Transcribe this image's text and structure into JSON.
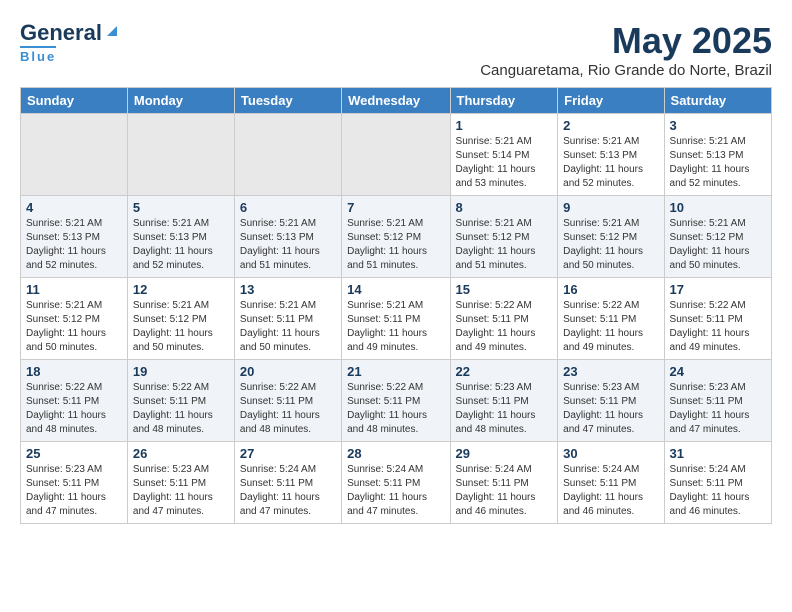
{
  "logo": {
    "line1": "General",
    "line2": "Blue"
  },
  "title": "May 2025",
  "subtitle": "Canguaretama, Rio Grande do Norte, Brazil",
  "days_of_week": [
    "Sunday",
    "Monday",
    "Tuesday",
    "Wednesday",
    "Thursday",
    "Friday",
    "Saturday"
  ],
  "weeks": [
    [
      {
        "day": "",
        "info": ""
      },
      {
        "day": "",
        "info": ""
      },
      {
        "day": "",
        "info": ""
      },
      {
        "day": "",
        "info": ""
      },
      {
        "day": "1",
        "info": "Sunrise: 5:21 AM\nSunset: 5:14 PM\nDaylight: 11 hours\nand 53 minutes."
      },
      {
        "day": "2",
        "info": "Sunrise: 5:21 AM\nSunset: 5:13 PM\nDaylight: 11 hours\nand 52 minutes."
      },
      {
        "day": "3",
        "info": "Sunrise: 5:21 AM\nSunset: 5:13 PM\nDaylight: 11 hours\nand 52 minutes."
      }
    ],
    [
      {
        "day": "4",
        "info": "Sunrise: 5:21 AM\nSunset: 5:13 PM\nDaylight: 11 hours\nand 52 minutes."
      },
      {
        "day": "5",
        "info": "Sunrise: 5:21 AM\nSunset: 5:13 PM\nDaylight: 11 hours\nand 52 minutes."
      },
      {
        "day": "6",
        "info": "Sunrise: 5:21 AM\nSunset: 5:13 PM\nDaylight: 11 hours\nand 51 minutes."
      },
      {
        "day": "7",
        "info": "Sunrise: 5:21 AM\nSunset: 5:12 PM\nDaylight: 11 hours\nand 51 minutes."
      },
      {
        "day": "8",
        "info": "Sunrise: 5:21 AM\nSunset: 5:12 PM\nDaylight: 11 hours\nand 51 minutes."
      },
      {
        "day": "9",
        "info": "Sunrise: 5:21 AM\nSunset: 5:12 PM\nDaylight: 11 hours\nand 50 minutes."
      },
      {
        "day": "10",
        "info": "Sunrise: 5:21 AM\nSunset: 5:12 PM\nDaylight: 11 hours\nand 50 minutes."
      }
    ],
    [
      {
        "day": "11",
        "info": "Sunrise: 5:21 AM\nSunset: 5:12 PM\nDaylight: 11 hours\nand 50 minutes."
      },
      {
        "day": "12",
        "info": "Sunrise: 5:21 AM\nSunset: 5:12 PM\nDaylight: 11 hours\nand 50 minutes."
      },
      {
        "day": "13",
        "info": "Sunrise: 5:21 AM\nSunset: 5:11 PM\nDaylight: 11 hours\nand 50 minutes."
      },
      {
        "day": "14",
        "info": "Sunrise: 5:21 AM\nSunset: 5:11 PM\nDaylight: 11 hours\nand 49 minutes."
      },
      {
        "day": "15",
        "info": "Sunrise: 5:22 AM\nSunset: 5:11 PM\nDaylight: 11 hours\nand 49 minutes."
      },
      {
        "day": "16",
        "info": "Sunrise: 5:22 AM\nSunset: 5:11 PM\nDaylight: 11 hours\nand 49 minutes."
      },
      {
        "day": "17",
        "info": "Sunrise: 5:22 AM\nSunset: 5:11 PM\nDaylight: 11 hours\nand 49 minutes."
      }
    ],
    [
      {
        "day": "18",
        "info": "Sunrise: 5:22 AM\nSunset: 5:11 PM\nDaylight: 11 hours\nand 48 minutes."
      },
      {
        "day": "19",
        "info": "Sunrise: 5:22 AM\nSunset: 5:11 PM\nDaylight: 11 hours\nand 48 minutes."
      },
      {
        "day": "20",
        "info": "Sunrise: 5:22 AM\nSunset: 5:11 PM\nDaylight: 11 hours\nand 48 minutes."
      },
      {
        "day": "21",
        "info": "Sunrise: 5:22 AM\nSunset: 5:11 PM\nDaylight: 11 hours\nand 48 minutes."
      },
      {
        "day": "22",
        "info": "Sunrise: 5:23 AM\nSunset: 5:11 PM\nDaylight: 11 hours\nand 48 minutes."
      },
      {
        "day": "23",
        "info": "Sunrise: 5:23 AM\nSunset: 5:11 PM\nDaylight: 11 hours\nand 47 minutes."
      },
      {
        "day": "24",
        "info": "Sunrise: 5:23 AM\nSunset: 5:11 PM\nDaylight: 11 hours\nand 47 minutes."
      }
    ],
    [
      {
        "day": "25",
        "info": "Sunrise: 5:23 AM\nSunset: 5:11 PM\nDaylight: 11 hours\nand 47 minutes."
      },
      {
        "day": "26",
        "info": "Sunrise: 5:23 AM\nSunset: 5:11 PM\nDaylight: 11 hours\nand 47 minutes."
      },
      {
        "day": "27",
        "info": "Sunrise: 5:24 AM\nSunset: 5:11 PM\nDaylight: 11 hours\nand 47 minutes."
      },
      {
        "day": "28",
        "info": "Sunrise: 5:24 AM\nSunset: 5:11 PM\nDaylight: 11 hours\nand 47 minutes."
      },
      {
        "day": "29",
        "info": "Sunrise: 5:24 AM\nSunset: 5:11 PM\nDaylight: 11 hours\nand 46 minutes."
      },
      {
        "day": "30",
        "info": "Sunrise: 5:24 AM\nSunset: 5:11 PM\nDaylight: 11 hours\nand 46 minutes."
      },
      {
        "day": "31",
        "info": "Sunrise: 5:24 AM\nSunset: 5:11 PM\nDaylight: 11 hours\nand 46 minutes."
      }
    ]
  ]
}
